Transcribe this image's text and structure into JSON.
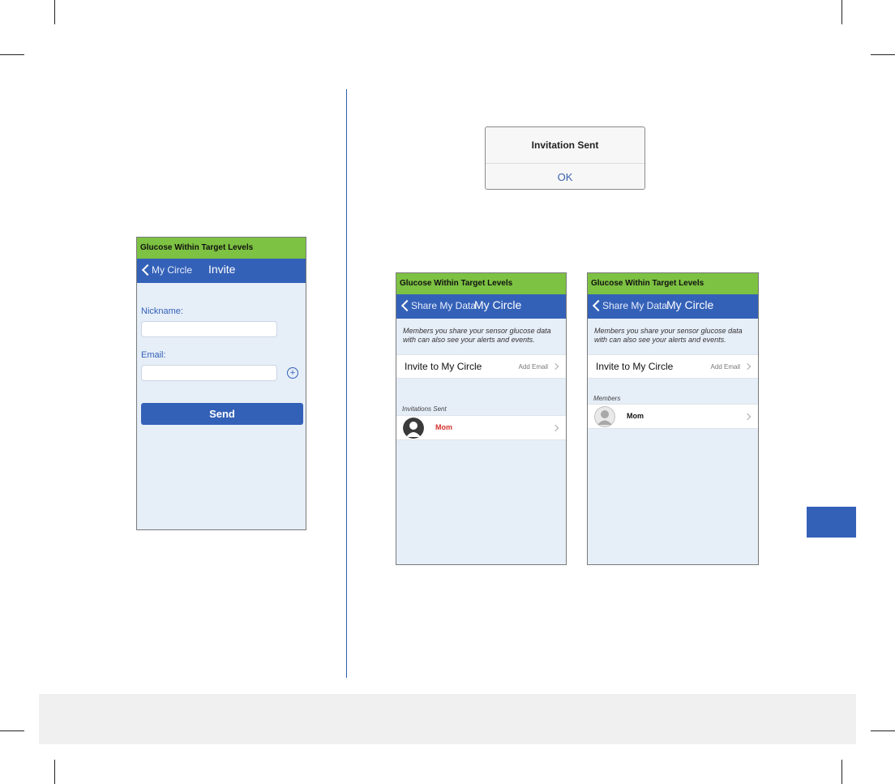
{
  "alert": {
    "title": "Invitation Sent",
    "ok_label": "OK"
  },
  "invite_screen": {
    "status": "Glucose Within Target Levels",
    "back_label": "My Circle",
    "title": "Invite",
    "nickname_label": "Nickname:",
    "nickname_value": "",
    "email_label": "Email:",
    "email_value": "",
    "add_icon": "plus-circle-icon",
    "send_label": "Send"
  },
  "circle_pending": {
    "status": "Glucose Within Target Levels",
    "back_label": "Share My Data",
    "title": "My Circle",
    "description": "Members you share your sensor glucose data with can also see your alerts and events.",
    "invite_label": "Invite to My Circle",
    "add_email_label": "Add Email",
    "section_label": "Invitations Sent",
    "member_name": "Mom",
    "member_color": "#d6322d"
  },
  "circle_accepted": {
    "status": "Glucose Within Target Levels",
    "back_label": "Share My Data",
    "title": "My Circle",
    "description": "Members you share your sensor glucose data with can also see your alerts and events.",
    "invite_label": "Invite to My Circle",
    "add_email_label": "Add Email",
    "section_label": "Members",
    "member_name": "Mom",
    "member_color": "#111111"
  },
  "colors": {
    "accent": "#3461b8",
    "status_green": "#7dc242",
    "screen_bg": "#e6eef8"
  }
}
